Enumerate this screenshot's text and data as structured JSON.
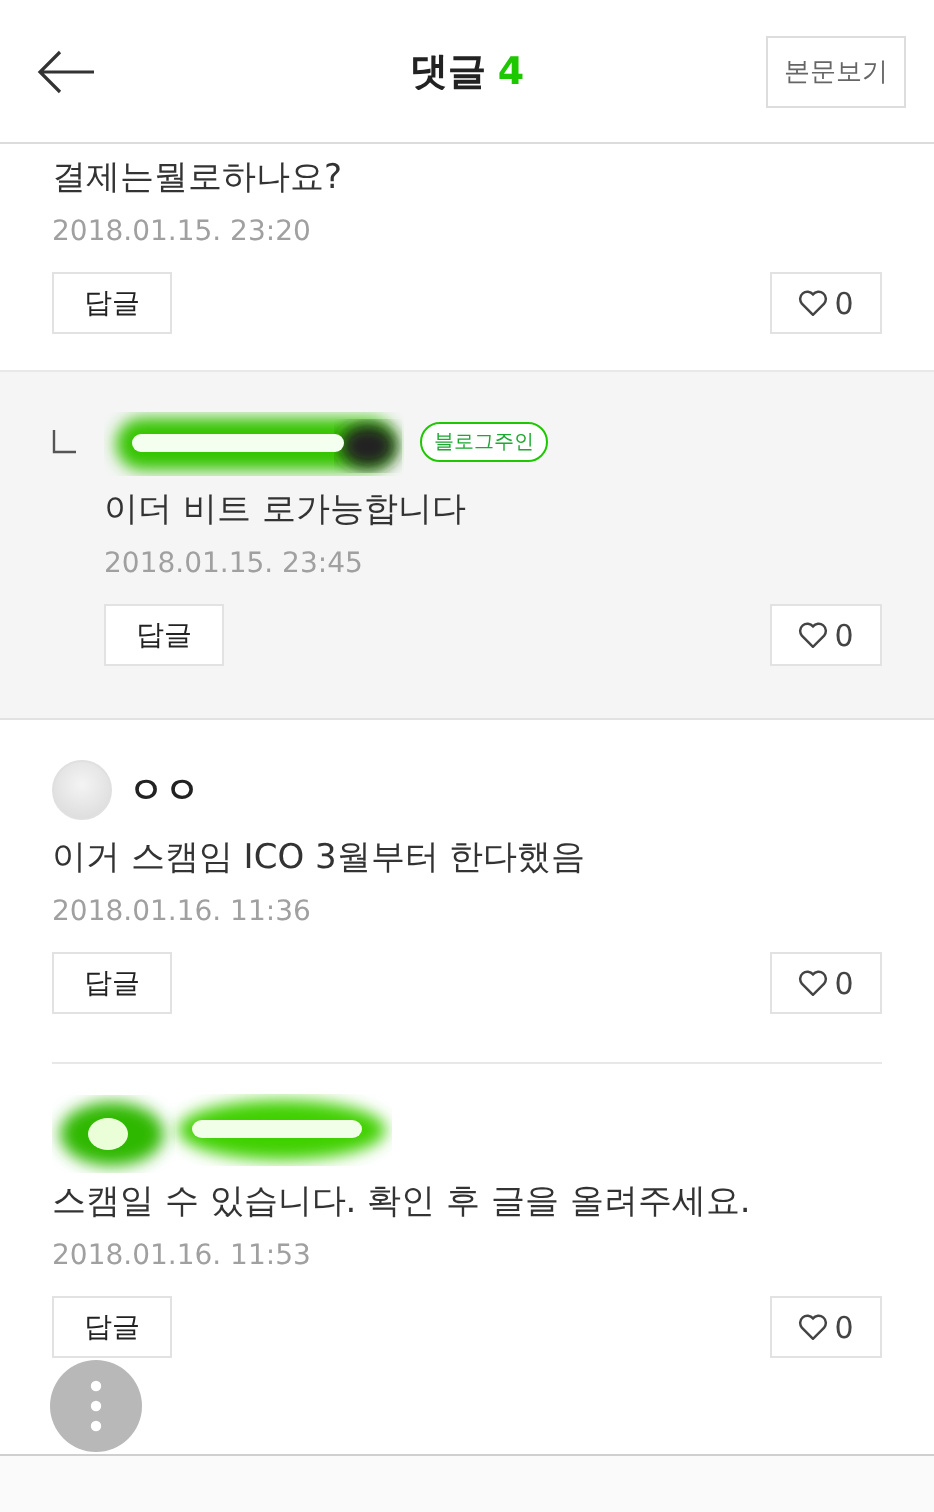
{
  "header": {
    "title": "댓글",
    "count": "4",
    "view_post_button": "본문보기"
  },
  "comments": [
    {
      "kind": "continued",
      "text": "결제는뭘로하나요?",
      "date": "2018.01.15. 23:20",
      "reply_button": "답글",
      "likes": "0"
    },
    {
      "kind": "reply",
      "author_redacted": true,
      "badge": "블로그주인",
      "text": "이더 비트 로가능합니다",
      "date": "2018.01.15. 23:45",
      "reply_button": "답글",
      "likes": "0"
    },
    {
      "kind": "comment",
      "author_redacted": false,
      "author": "ㅇㅇ",
      "text": "이거 스캠임 ICO 3월부터 한다했음",
      "date": "2018.01.16. 11:36",
      "reply_button": "답글",
      "likes": "0"
    },
    {
      "kind": "comment",
      "author_redacted": true,
      "text": "스캠일 수 있습니다. 확인 후 글을 올려주세요.",
      "date": "2018.01.16. 11:53",
      "reply_button": "답글",
      "likes": "0"
    }
  ]
}
